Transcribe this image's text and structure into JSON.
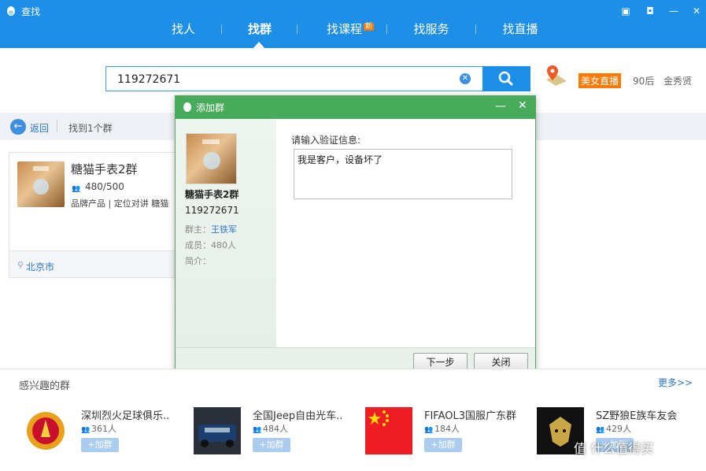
{
  "window": {
    "title": "查找",
    "accent": "#1e8fe6"
  },
  "nav": {
    "tabs": [
      {
        "label": "找人",
        "active": false
      },
      {
        "label": "找群",
        "active": true
      },
      {
        "label": "找课程",
        "badge": "新",
        "active": false
      },
      {
        "label": "找服务",
        "active": false
      },
      {
        "label": "找直播",
        "active": false
      }
    ]
  },
  "search": {
    "value": "119272671",
    "tags": [
      "美女直播",
      "90后",
      "金秀贤"
    ]
  },
  "results": {
    "back_label": "返回",
    "found_label": "找到1个群"
  },
  "group_card": {
    "name": "糖猫手表2群",
    "members": "480/500",
    "tags": "品牌产品 | 定位对讲 糖猫",
    "location": "北京市"
  },
  "dialog": {
    "title": "添加群",
    "group_name": "糖猫手表2群",
    "group_id": "119272671",
    "owner_label": "群主：",
    "owner_name": "王铁军",
    "members_label": "成员：480人",
    "intro_label": "简介：",
    "verify_label": "请输入验证信息:",
    "verify_text": "我是客户，设备坏了",
    "next_button": "下一步",
    "close_button": "关闭"
  },
  "interested": {
    "title": "感兴趣的群",
    "more": "更多>>",
    "groups": [
      {
        "name": "深圳烈火足球俱乐..",
        "count": "361人",
        "join": "+加群"
      },
      {
        "name": "全国Jeep自由光车..",
        "count": "484人",
        "join": "+加群"
      },
      {
        "name": "FIFAOL3国服广东群",
        "count": "184人",
        "join": "+加群"
      },
      {
        "name": "SZ野狼E族车友会",
        "count": "429人",
        "join": "+加群"
      }
    ]
  },
  "watermark": "值 什么值得买"
}
